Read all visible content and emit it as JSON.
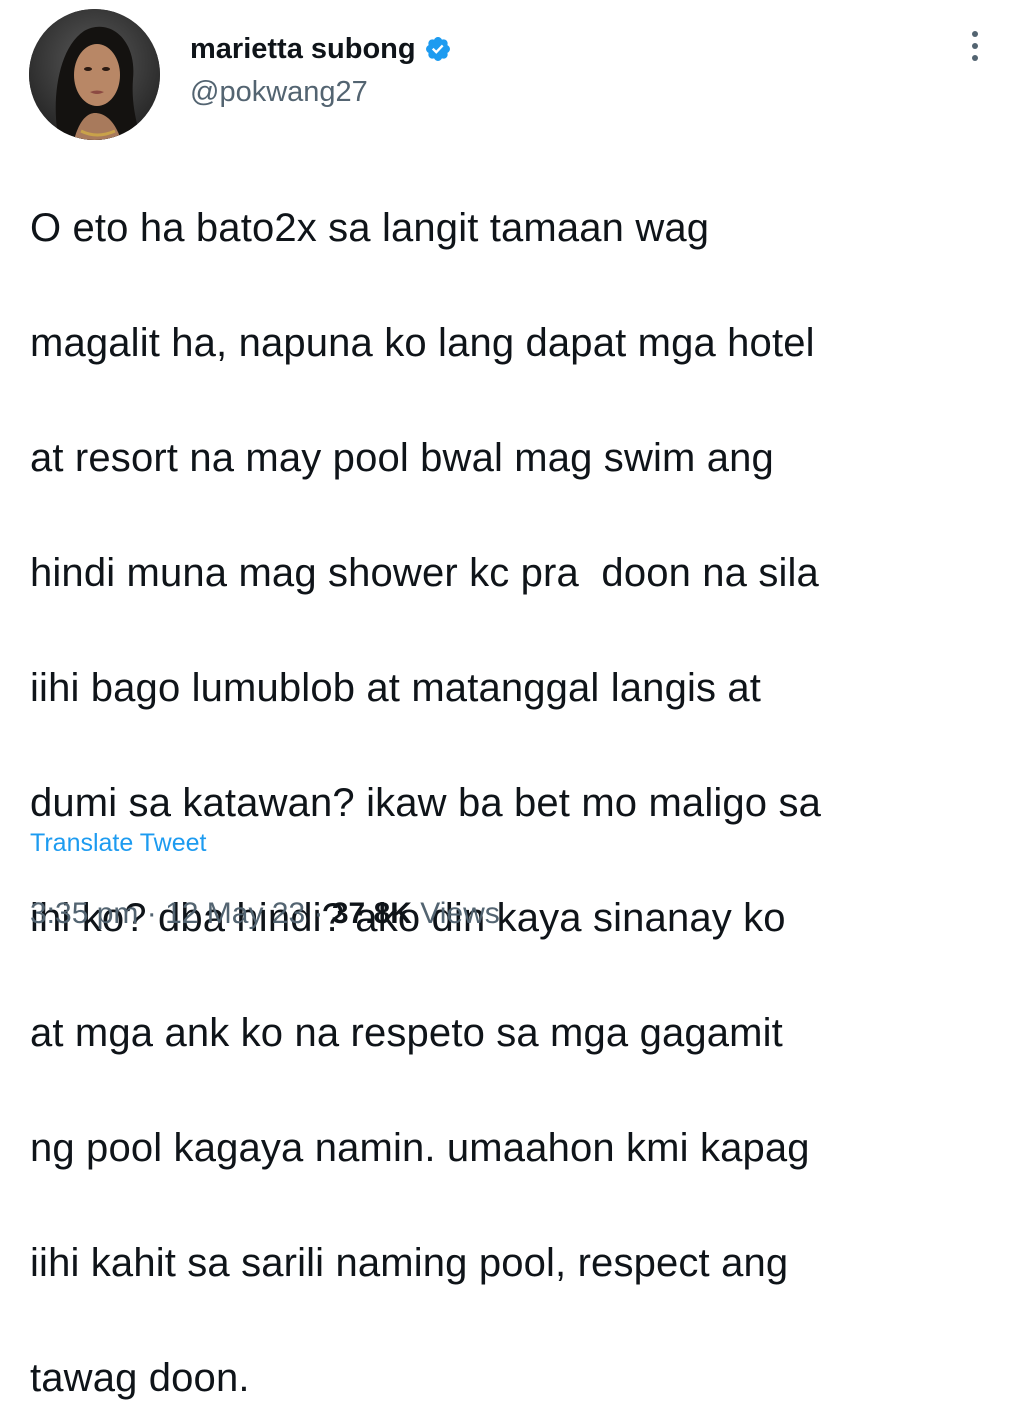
{
  "author": {
    "display_name": "marietta subong",
    "handle": "@pokwang27",
    "verified": true,
    "verified_color": "#1d9bf0"
  },
  "tweet": {
    "lines": [
      "O eto ha bato2x sa langit tamaan wag",
      "magalit ha, napuna ko lang dapat mga hotel",
      "at resort na may pool bwal mag swim ang",
      "hindi muna mag shower kc pra  doon na sila",
      "iihi bago lumublob at matanggal langis at",
      "dumi sa katawan? ikaw ba bet mo maligo sa",
      "ihi ko? dba hindi? ako din kaya sinanay ko",
      "at mga ank ko na respeto sa mga gagamit",
      "ng pool kagaya namin. umaahon kmi kapag",
      "iihi kahit sa sarili naming pool, respect ang",
      "tawag doon."
    ],
    "translate_label": "Translate Tweet",
    "time": "3:35 pm",
    "separator": "·",
    "date": "12 May 23",
    "views_count": "37.8K",
    "views_label": "Views"
  },
  "icons": {
    "avatar": "profile-photo",
    "verified": "verified-badge-icon",
    "more": "more-options-icon"
  },
  "colors": {
    "accent": "#1d9bf0",
    "text": "#0f1419",
    "muted": "#536471"
  }
}
